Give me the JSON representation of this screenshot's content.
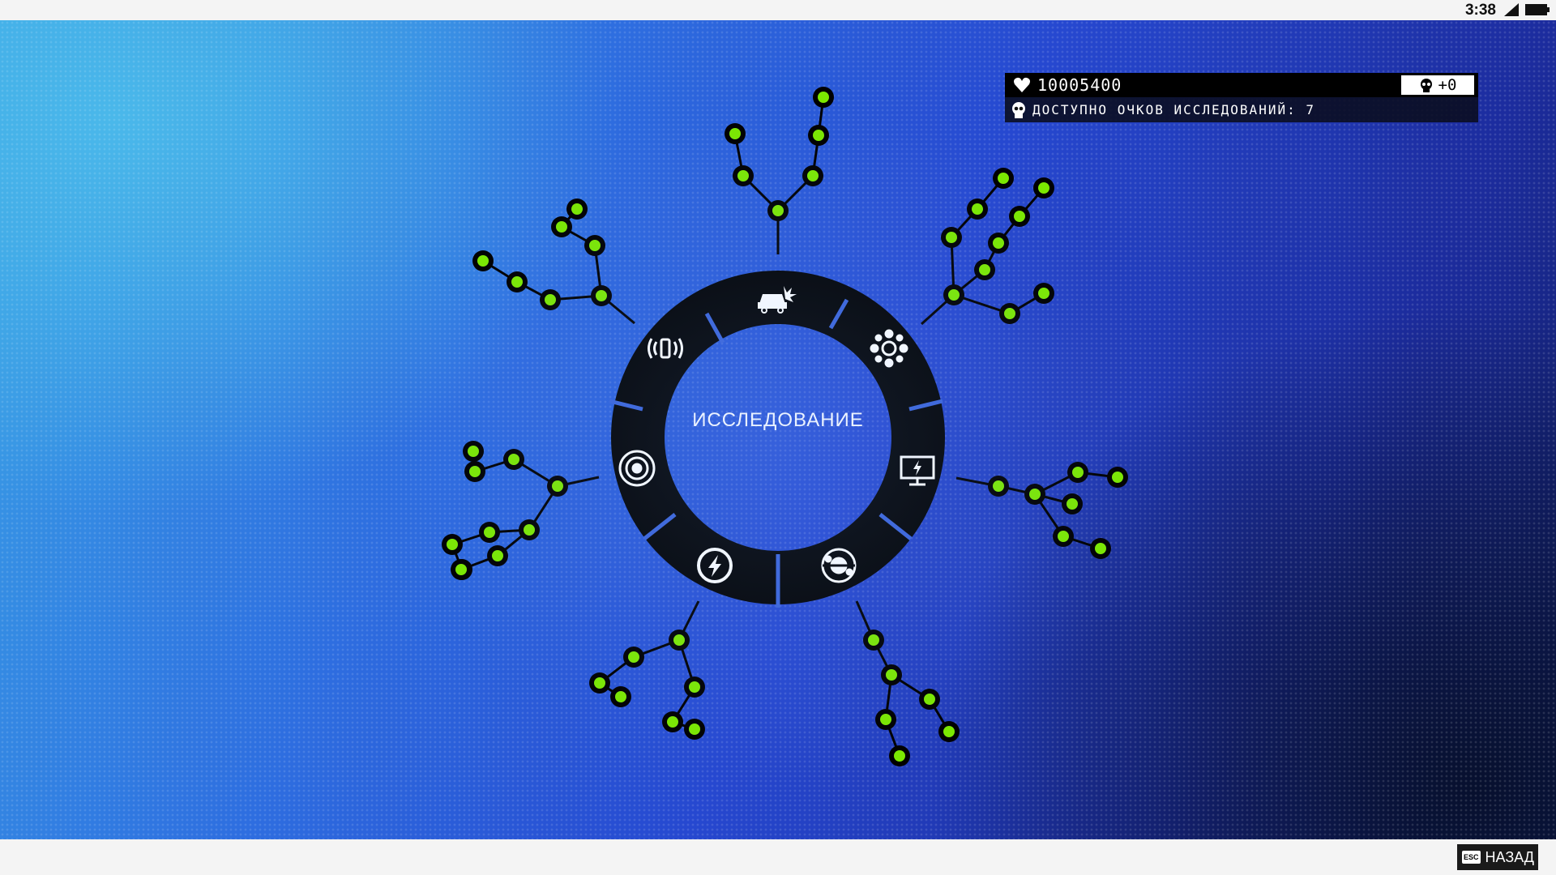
{
  "status": {
    "time": "3:38"
  },
  "hud": {
    "money": "10005400",
    "bonus": "+0",
    "research_points_label": "ДОСТУПНО ОЧКОВ ИССЛЕДОВАНИЙ: 7"
  },
  "wheel": {
    "title": "ИССЛЕДОВАНИЕ",
    "segments": [
      "car-hack-icon",
      "network-people-icon",
      "monitor-power-icon",
      "tech-gear-icon",
      "lightning-icon",
      "target-icon",
      "phone-signal-icon"
    ]
  },
  "footer": {
    "esc_key": "ESC",
    "back_label": "НАЗАД"
  },
  "colors": {
    "node": "#7be800",
    "ring": "#000000",
    "bg_accent": "#2e6ee0"
  }
}
